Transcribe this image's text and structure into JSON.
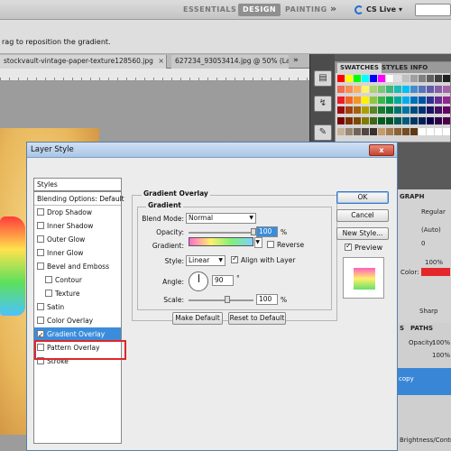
{
  "app": {
    "workspaces": [
      "ESSENTIALS",
      "DESIGN",
      "PAINTING"
    ],
    "active_workspace": "DESIGN",
    "more": "»",
    "cs_live": "CS Live",
    "hint": "rag to reposition the gradient."
  },
  "documents": {
    "tabs": [
      {
        "label": "stockvault-vintage-paper-texture128560.jpg",
        "close": "×"
      },
      {
        "label": "627234_93053414.jpg @ 50% (Laye",
        "close": ""
      }
    ],
    "tabs_more": "»"
  },
  "swatches_panel": {
    "tabs": [
      "SWATCHES",
      "STYLES",
      "INFO"
    ],
    "active_tab": "SWATCHES",
    "colors": [
      "#ff0000",
      "#ffff00",
      "#00ff00",
      "#00ffff",
      "#0000ff",
      "#ff00ff",
      "#ffffff",
      "#e0e0e0",
      "#c0c0c0",
      "#a0a0a0",
      "#808080",
      "#606060",
      "#404040",
      "#202020",
      "#f26c4f",
      "#f68e55",
      "#fbaf5c",
      "#fff467",
      "#acd372",
      "#7cc576",
      "#3bb878",
      "#1abbb4",
      "#00bff3",
      "#438ccb",
      "#5574b9",
      "#605ca8",
      "#855fa8",
      "#a763a8",
      "#ed1c24",
      "#f26522",
      "#f7941d",
      "#fff200",
      "#8dc63f",
      "#39b54a",
      "#00a651",
      "#00a99d",
      "#00aeef",
      "#0072bc",
      "#0054a6",
      "#2e3192",
      "#662d91",
      "#92278f",
      "#9e0b0f",
      "#a0410d",
      "#a36209",
      "#aba000",
      "#598527",
      "#1a7b30",
      "#007236",
      "#00746b",
      "#0076a3",
      "#004b80",
      "#003471",
      "#1b1464",
      "#440e62",
      "#630460",
      "#790000",
      "#7b2e00",
      "#7d4900",
      "#827b00",
      "#406618",
      "#005e20",
      "#005826",
      "#005952",
      "#005b7f",
      "#003663",
      "#002157",
      "#0d004c",
      "#32004b",
      "#4b0049",
      "#c7b299",
      "#998675",
      "#736357",
      "#534741",
      "#37302d",
      "#c69c6d",
      "#a67c52",
      "#8c6239",
      "#754c24",
      "#603913",
      "#ffffff",
      "#ffffff",
      "#ffffff",
      "#ffffff"
    ]
  },
  "right_panels": {
    "char_label": "GRAPH",
    "font_style": "Regular",
    "auto": "(Auto)",
    "zero": "0",
    "color_label": "Color:",
    "percent": "100%",
    "sharp": "Sharp",
    "layers_tabs": [
      "S",
      "PATHS"
    ],
    "opacity": "Opacity:",
    "layers_copy": "copy",
    "bottom_label": "Brightness/Contr..."
  },
  "dialog": {
    "title": "Layer Style",
    "close": "x",
    "styles_header": "Styles",
    "blending": "Blending Options: Default",
    "items": [
      {
        "label": "Drop Shadow",
        "checked": false,
        "indent": false
      },
      {
        "label": "Inner Shadow",
        "checked": false,
        "indent": false
      },
      {
        "label": "Outer Glow",
        "checked": false,
        "indent": false
      },
      {
        "label": "Inner Glow",
        "checked": false,
        "indent": false
      },
      {
        "label": "Bevel and Emboss",
        "checked": false,
        "indent": false
      },
      {
        "label": "Contour",
        "checked": false,
        "indent": true
      },
      {
        "label": "Texture",
        "checked": false,
        "indent": true
      },
      {
        "label": "Satin",
        "checked": false,
        "indent": false
      },
      {
        "label": "Color Overlay",
        "checked": false,
        "indent": false
      },
      {
        "label": "Gradient Overlay",
        "checked": true,
        "indent": false,
        "selected": true
      },
      {
        "label": "Pattern Overlay",
        "checked": false,
        "indent": false
      },
      {
        "label": "Stroke",
        "checked": false,
        "indent": false
      }
    ],
    "group_title": "Gradient Overlay",
    "subgroup_title": "Gradient",
    "blend_mode_label": "Blend Mode:",
    "blend_mode_value": "Normal",
    "opacity_label": "Opacity:",
    "opacity_value": "100",
    "opacity_unit": "%",
    "opacity_level": 1.0,
    "gradient_label": "Gradient:",
    "reverse_label": "Reverse",
    "style_label": "Style:",
    "style_value": "Linear",
    "align_label": "Align with Layer",
    "angle_label": "Angle:",
    "angle_value": "90",
    "angle_unit": "°",
    "scale_label": "Scale:",
    "scale_value": "100",
    "scale_unit": "%",
    "scale_level": 0.6,
    "make_default": "Make Default",
    "reset_default": "Reset to Default",
    "ok": "OK",
    "cancel": "Cancel",
    "new_style": "New Style...",
    "preview_label": "Preview",
    "preview_checked": true
  }
}
